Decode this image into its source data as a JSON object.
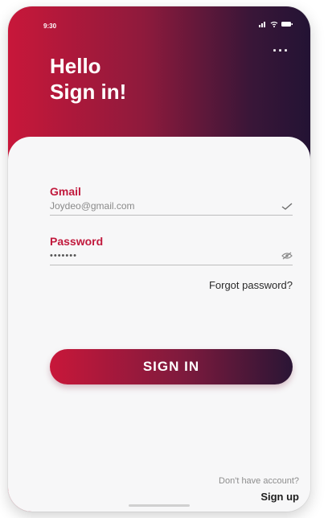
{
  "status_bar": {
    "time": "9:30"
  },
  "header": {
    "greeting_line1": "Hello",
    "greeting_line2": "Sign in!",
    "menu_icon": "more-dots-icon"
  },
  "form": {
    "email_label": "Gmail",
    "email_value": "Joydeo@gmail.com",
    "password_label": "Password",
    "password_value": "•••••••",
    "forgot_password": "Forgot password?",
    "sign_in_button": "SIGN IN"
  },
  "footer": {
    "no_account": "Don't have account?",
    "sign_up": "Sign up"
  },
  "colors": {
    "accent": "#c8173a",
    "dark": "#231334",
    "label": "#c11a3d"
  }
}
